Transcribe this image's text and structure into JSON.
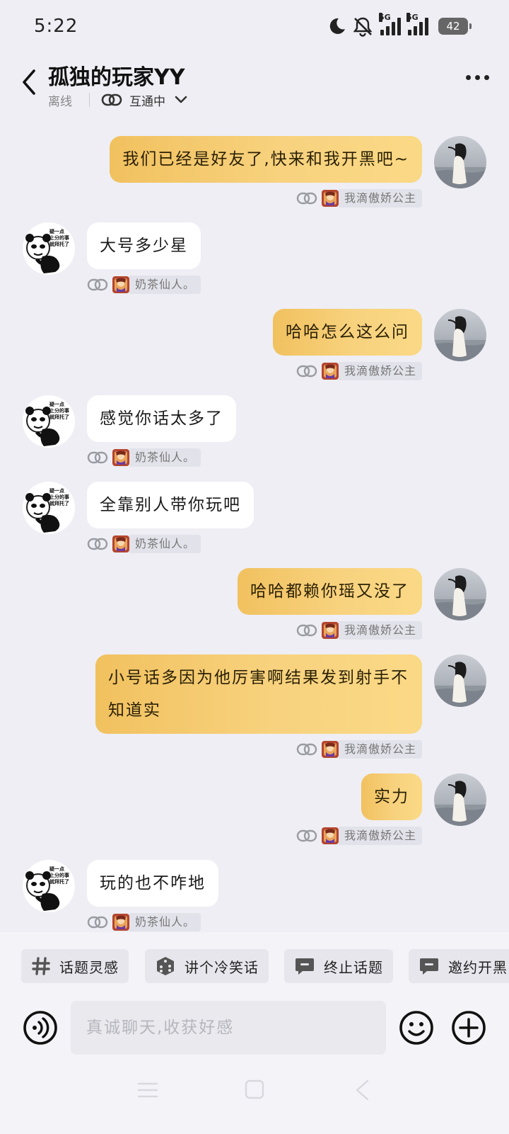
{
  "status_bar": {
    "time": "5:22",
    "battery": "42",
    "network_1": "5G",
    "network_2": "5G"
  },
  "header": {
    "title": "孤独的玩家YY",
    "status": "离线",
    "relation": "互通中"
  },
  "messages": [
    {
      "dir": "out",
      "text": "我们已经是好友了,快来和我开黑吧~",
      "tag": "我滴傲娇公主"
    },
    {
      "dir": "in",
      "text": "大号多少星",
      "tag": "奶茶仙人。"
    },
    {
      "dir": "out",
      "text": "哈哈怎么这么问",
      "tag": "我滴傲娇公主"
    },
    {
      "dir": "in",
      "text": "感觉你话太多了",
      "tag": "奶茶仙人。"
    },
    {
      "dir": "in",
      "text": "全靠别人带你玩吧",
      "tag": "奶茶仙人。"
    },
    {
      "dir": "out",
      "text": "哈哈都赖你瑶又没了",
      "tag": "我滴傲娇公主"
    },
    {
      "dir": "out",
      "text": "小号话多因为他厉害啊结果发到射手不知道实",
      "tag": "我滴傲娇公主"
    },
    {
      "dir": "out",
      "text": "实力",
      "tag": "我滴傲娇公主"
    },
    {
      "dir": "in",
      "text": "玩的也不咋地",
      "tag": "奶茶仙人。"
    }
  ],
  "avatar_text": {
    "line1": "疑一点",
    "line2": "上分的事",
    "line3": "就拜托了"
  },
  "quick_actions": [
    "话题灵感",
    "讲个冷笑话",
    "终止话题",
    "邀约开黑"
  ],
  "input": {
    "placeholder": "真诚聊天,收获好感"
  },
  "colors": {
    "outgoing_bubble": "#f6ce76",
    "incoming_bubble": "#ffffff",
    "background": "#eeeef4"
  }
}
